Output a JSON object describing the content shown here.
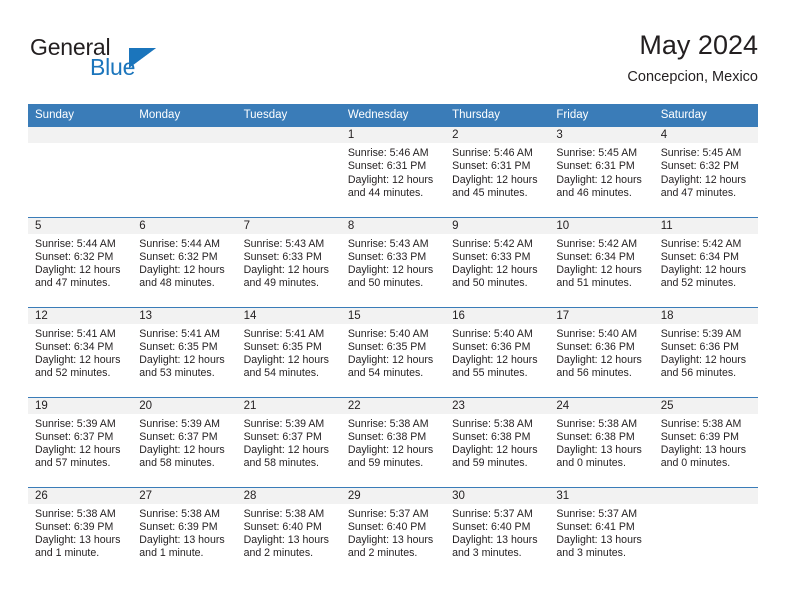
{
  "logo": {
    "word_top": "General",
    "word_bottom": "Blue",
    "flag_icon": "blue-triangle-flag-icon",
    "color_text": "#231f20",
    "color_blue": "#1b75bc"
  },
  "header": {
    "title": "May 2024",
    "subtitle": "Concepcion, Mexico"
  },
  "theme": {
    "header_blue": "#3a7cb8",
    "daynum_band": "#f2f2f2",
    "text": "#231f20"
  },
  "weekdays": [
    "Sunday",
    "Monday",
    "Tuesday",
    "Wednesday",
    "Thursday",
    "Friday",
    "Saturday"
  ],
  "weeks": [
    [
      {
        "day": "",
        "empty": true
      },
      {
        "day": "",
        "empty": true
      },
      {
        "day": "",
        "empty": true
      },
      {
        "day": "1",
        "sunrise": "Sunrise: 5:46 AM",
        "sunset": "Sunset: 6:31 PM",
        "daylight": "Daylight: 12 hours and 44 minutes."
      },
      {
        "day": "2",
        "sunrise": "Sunrise: 5:46 AM",
        "sunset": "Sunset: 6:31 PM",
        "daylight": "Daylight: 12 hours and 45 minutes."
      },
      {
        "day": "3",
        "sunrise": "Sunrise: 5:45 AM",
        "sunset": "Sunset: 6:31 PM",
        "daylight": "Daylight: 12 hours and 46 minutes."
      },
      {
        "day": "4",
        "sunrise": "Sunrise: 5:45 AM",
        "sunset": "Sunset: 6:32 PM",
        "daylight": "Daylight: 12 hours and 47 minutes."
      }
    ],
    [
      {
        "day": "5",
        "sunrise": "Sunrise: 5:44 AM",
        "sunset": "Sunset: 6:32 PM",
        "daylight": "Daylight: 12 hours and 47 minutes."
      },
      {
        "day": "6",
        "sunrise": "Sunrise: 5:44 AM",
        "sunset": "Sunset: 6:32 PM",
        "daylight": "Daylight: 12 hours and 48 minutes."
      },
      {
        "day": "7",
        "sunrise": "Sunrise: 5:43 AM",
        "sunset": "Sunset: 6:33 PM",
        "daylight": "Daylight: 12 hours and 49 minutes."
      },
      {
        "day": "8",
        "sunrise": "Sunrise: 5:43 AM",
        "sunset": "Sunset: 6:33 PM",
        "daylight": "Daylight: 12 hours and 50 minutes."
      },
      {
        "day": "9",
        "sunrise": "Sunrise: 5:42 AM",
        "sunset": "Sunset: 6:33 PM",
        "daylight": "Daylight: 12 hours and 50 minutes."
      },
      {
        "day": "10",
        "sunrise": "Sunrise: 5:42 AM",
        "sunset": "Sunset: 6:34 PM",
        "daylight": "Daylight: 12 hours and 51 minutes."
      },
      {
        "day": "11",
        "sunrise": "Sunrise: 5:42 AM",
        "sunset": "Sunset: 6:34 PM",
        "daylight": "Daylight: 12 hours and 52 minutes."
      }
    ],
    [
      {
        "day": "12",
        "sunrise": "Sunrise: 5:41 AM",
        "sunset": "Sunset: 6:34 PM",
        "daylight": "Daylight: 12 hours and 52 minutes."
      },
      {
        "day": "13",
        "sunrise": "Sunrise: 5:41 AM",
        "sunset": "Sunset: 6:35 PM",
        "daylight": "Daylight: 12 hours and 53 minutes."
      },
      {
        "day": "14",
        "sunrise": "Sunrise: 5:41 AM",
        "sunset": "Sunset: 6:35 PM",
        "daylight": "Daylight: 12 hours and 54 minutes."
      },
      {
        "day": "15",
        "sunrise": "Sunrise: 5:40 AM",
        "sunset": "Sunset: 6:35 PM",
        "daylight": "Daylight: 12 hours and 54 minutes."
      },
      {
        "day": "16",
        "sunrise": "Sunrise: 5:40 AM",
        "sunset": "Sunset: 6:36 PM",
        "daylight": "Daylight: 12 hours and 55 minutes."
      },
      {
        "day": "17",
        "sunrise": "Sunrise: 5:40 AM",
        "sunset": "Sunset: 6:36 PM",
        "daylight": "Daylight: 12 hours and 56 minutes."
      },
      {
        "day": "18",
        "sunrise": "Sunrise: 5:39 AM",
        "sunset": "Sunset: 6:36 PM",
        "daylight": "Daylight: 12 hours and 56 minutes."
      }
    ],
    [
      {
        "day": "19",
        "sunrise": "Sunrise: 5:39 AM",
        "sunset": "Sunset: 6:37 PM",
        "daylight": "Daylight: 12 hours and 57 minutes."
      },
      {
        "day": "20",
        "sunrise": "Sunrise: 5:39 AM",
        "sunset": "Sunset: 6:37 PM",
        "daylight": "Daylight: 12 hours and 58 minutes."
      },
      {
        "day": "21",
        "sunrise": "Sunrise: 5:39 AM",
        "sunset": "Sunset: 6:37 PM",
        "daylight": "Daylight: 12 hours and 58 minutes."
      },
      {
        "day": "22",
        "sunrise": "Sunrise: 5:38 AM",
        "sunset": "Sunset: 6:38 PM",
        "daylight": "Daylight: 12 hours and 59 minutes."
      },
      {
        "day": "23",
        "sunrise": "Sunrise: 5:38 AM",
        "sunset": "Sunset: 6:38 PM",
        "daylight": "Daylight: 12 hours and 59 minutes."
      },
      {
        "day": "24",
        "sunrise": "Sunrise: 5:38 AM",
        "sunset": "Sunset: 6:38 PM",
        "daylight": "Daylight: 13 hours and 0 minutes."
      },
      {
        "day": "25",
        "sunrise": "Sunrise: 5:38 AM",
        "sunset": "Sunset: 6:39 PM",
        "daylight": "Daylight: 13 hours and 0 minutes."
      }
    ],
    [
      {
        "day": "26",
        "sunrise": "Sunrise: 5:38 AM",
        "sunset": "Sunset: 6:39 PM",
        "daylight": "Daylight: 13 hours and 1 minute."
      },
      {
        "day": "27",
        "sunrise": "Sunrise: 5:38 AM",
        "sunset": "Sunset: 6:39 PM",
        "daylight": "Daylight: 13 hours and 1 minute."
      },
      {
        "day": "28",
        "sunrise": "Sunrise: 5:38 AM",
        "sunset": "Sunset: 6:40 PM",
        "daylight": "Daylight: 13 hours and 2 minutes."
      },
      {
        "day": "29",
        "sunrise": "Sunrise: 5:37 AM",
        "sunset": "Sunset: 6:40 PM",
        "daylight": "Daylight: 13 hours and 2 minutes."
      },
      {
        "day": "30",
        "sunrise": "Sunrise: 5:37 AM",
        "sunset": "Sunset: 6:40 PM",
        "daylight": "Daylight: 13 hours and 3 minutes."
      },
      {
        "day": "31",
        "sunrise": "Sunrise: 5:37 AM",
        "sunset": "Sunset: 6:41 PM",
        "daylight": "Daylight: 13 hours and 3 minutes."
      },
      {
        "day": "",
        "empty": true
      }
    ]
  ]
}
